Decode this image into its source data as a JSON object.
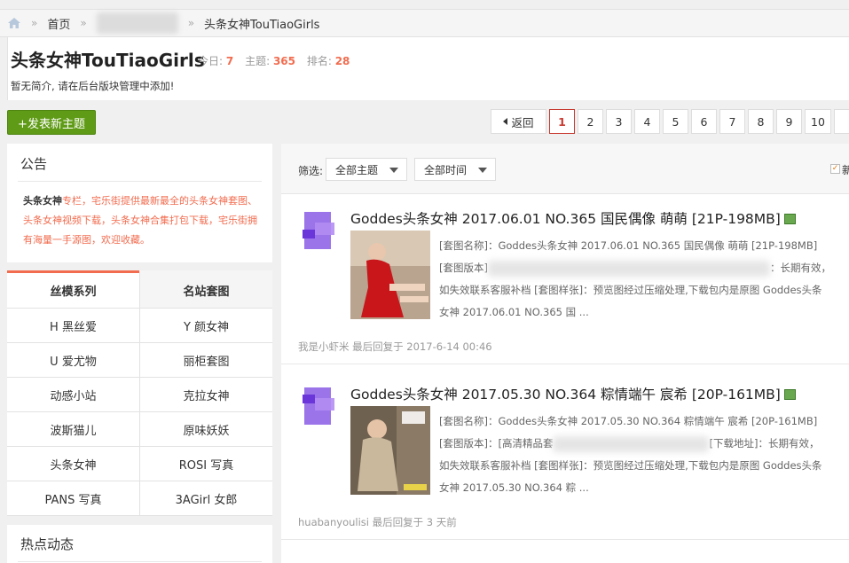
{
  "breadcrumb": {
    "home_icon": "home-icon",
    "sep": "»",
    "home_label": "首页",
    "forum_label": "头条女神TouTiaoGirls"
  },
  "forum": {
    "title": "头条女神TouTiaoGirls",
    "today_label": "今日:",
    "today_value": "7",
    "topics_label": "主题:",
    "topics_value": "365",
    "rank_label": "排名:",
    "rank_value": "28",
    "intro": "暂无简介, 请在后台版块管理中添加!"
  },
  "post_button": "+发表新主题",
  "pager": {
    "back": "返回",
    "pages": [
      "1",
      "2",
      "3",
      "4",
      "5",
      "6",
      "7",
      "8",
      "9",
      "10"
    ],
    "current": "1"
  },
  "notice": {
    "title": "公告",
    "brand": "头条女神",
    "text": "专栏，宅乐街提供最新最全的头条女神套图、头条女神视频下载，头条女神合集打包下载，宅乐街拥有海量一手源图，欢迎收藏。"
  },
  "categories": {
    "tabs": [
      "丝模系列",
      "名站套图"
    ],
    "items": [
      "H 黑丝爱",
      "Y 颜女神",
      "U 爱尤物",
      "丽柜套图",
      "动感小站",
      "克拉女神",
      "波斯猫儿",
      "原味妖妖",
      "头条女神",
      "ROSI 写真",
      "PANS 写真",
      "3AGirl 女郎"
    ]
  },
  "hot": {
    "title": "热点动态"
  },
  "filter": {
    "label": "筛选:",
    "topic_option": "全部主题",
    "time_option": "全部时间",
    "new_label": "新"
  },
  "threads": [
    {
      "title": "Goddes头条女神 2017.06.01 NO.365 国民偶像 萌萌 [21P-198MB]",
      "desc_1": "[套图名称]：Goddes头条女神 2017.06.01 NO.365 国民偶像 萌萌 [21P-198MB]",
      "desc_2a": "[套图版本]",
      "desc_2b": "：长期有效，",
      "desc_3": "如失效联系客服补档 [套图样张]：预览图经过压缩处理,下载包内是原图 Goddes头条",
      "desc_4": "女神 2017.06.01 NO.365 国 ...",
      "meta": "我是小虾米 最后回复于 2017-6-14 00:46"
    },
    {
      "title": "Goddes头条女神 2017.05.30 NO.364 粽情端午 宸希 [20P-161MB]",
      "desc_1": "[套图名称]：Goddes头条女神 2017.05.30 NO.364 粽情端午 宸希 [20P-161MB]",
      "desc_2a": "[套图版本]：[高清精品套",
      "desc_2b": "[下载地址]：长期有效，",
      "desc_3": "如失效联系客服补档 [套图样张]：预览图经过压缩处理,下载包内是原图 Goddes头条",
      "desc_4": "女神 2017.05.30 NO.364 粽 ...",
      "meta": "huabanyoulisi 最后回复于 3 天前"
    }
  ],
  "colors": {
    "accent": "#f26c4f",
    "post_button": "#5f9b16",
    "current_page": "#c83a30"
  }
}
